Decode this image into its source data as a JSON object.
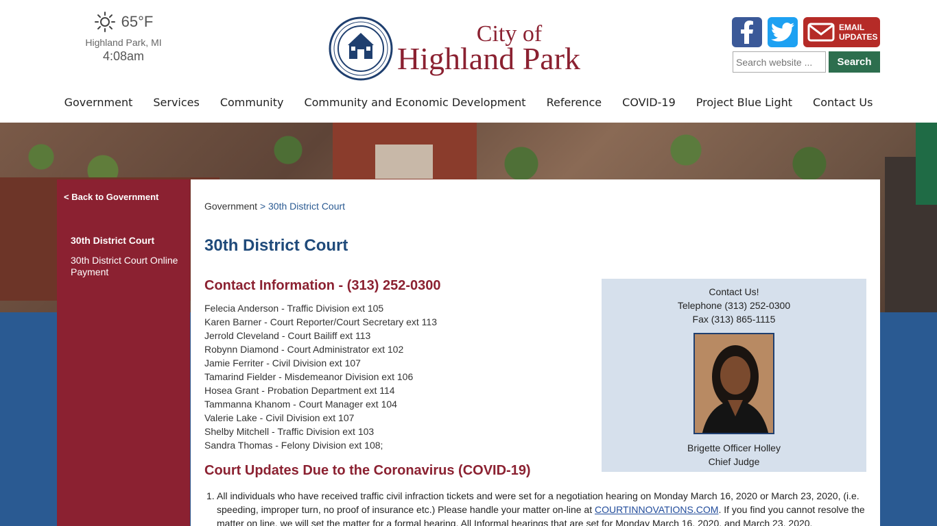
{
  "weather": {
    "icon": "sun-icon",
    "temperature": "65°F",
    "location": "Highland Park, MI",
    "time": "4:08am"
  },
  "logo": {
    "city_of": "City of",
    "name": "Highland Park",
    "seal_text": "CITY OF HIGHLAND PARK MICHIGAN · INCORPORATED 1918"
  },
  "social": {
    "facebook_icon": "facebook-icon",
    "twitter_icon": "twitter-icon",
    "email_line1": "EMAIL",
    "email_line2": "UPDATES"
  },
  "search": {
    "placeholder": "Search website ...",
    "button": "Search"
  },
  "nav": [
    "Government",
    "Services",
    "Community",
    "Community and Economic Development",
    "Reference",
    "COVID-19",
    "Project Blue Light",
    "Contact Us"
  ],
  "sidebar": {
    "back": "< Back to Government",
    "active_item": "30th District Court",
    "item2": "30th District Court Online Payment"
  },
  "breadcrumb": {
    "root": "Government",
    "sep": ">",
    "current": "30th District Court"
  },
  "page_title": "30th District Court",
  "contact_heading": "Contact Information - (313) 252-0300",
  "contacts": [
    "Felecia Anderson - Traffic Division ext 105",
    "Karen Barner - Court Reporter/Court Secretary ext 113",
    "Jerrold Cleveland - Court Bailiff ext 113",
    "Robynn Diamond - Court Administrator ext 102",
    "Jamie Ferriter - Civil Division ext 107",
    "Tamarind Fielder - Misdemeanor Division ext 106",
    "Hosea Grant - Probation Department ext 114",
    "Tammanna Khanom - Court Manager ext 104",
    "Valerie Lake - Civil Division ext 107",
    "Shelby Mitchell - Traffic Division ext 103",
    "Sandra Thomas - Felony Division ext 108;"
  ],
  "contact_box": {
    "title": "Contact Us!",
    "telephone": "Telephone (313) 252-0300",
    "fax": "Fax (313) 865-1115",
    "judge_name": "Brigette Officer Holley",
    "judge_title": "Chief Judge"
  },
  "covid_heading": "Court Updates Due to the Coronavirus (COVID-19)",
  "updates": {
    "num": "1.",
    "text1": "All individuals who have received traffic civil infraction tickets and were set for a negotiation hearing on Monday March 16, 2020 or March 23, 2020, (i.e. speeding, improper turn, no proof of insurance etc.) Please handle your matter on-line at ",
    "link": "COURTINNOVATIONS.COM",
    "text2": ". If you find you cannot resolve the matter on line, we will set the matter for a formal hearing. All Informal hearings that are set for Monday March 16, 2020, and March 23, 2020,"
  }
}
